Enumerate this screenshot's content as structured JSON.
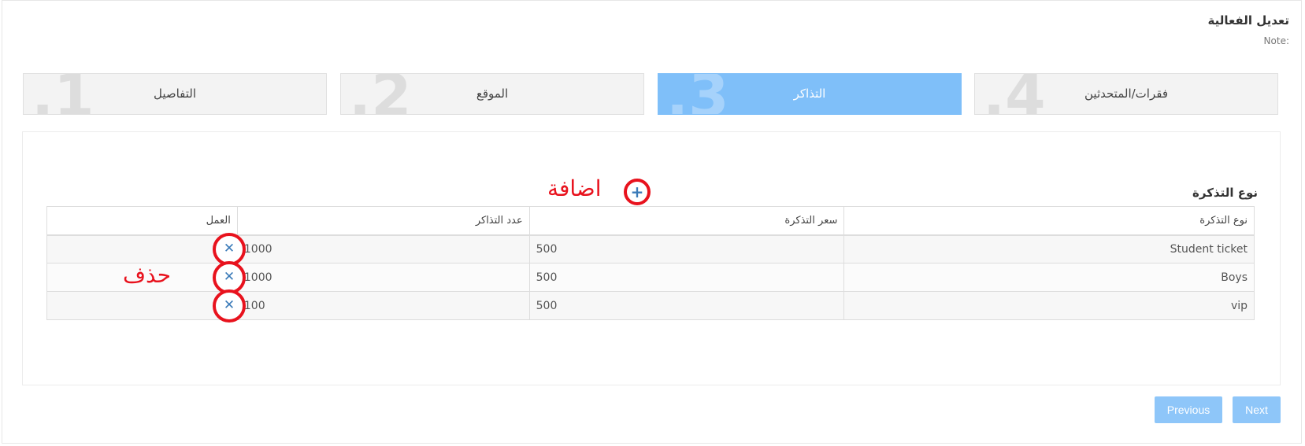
{
  "page": {
    "title": "تعديل الفعالية",
    "note": ":Note"
  },
  "steps": [
    {
      "number": ".1",
      "label": "التفاصيل",
      "active": false
    },
    {
      "number": ".2",
      "label": "الموقع",
      "active": false
    },
    {
      "number": ".3",
      "label": "التذاكر",
      "active": true
    },
    {
      "number": ".4",
      "label": "فقرات/المتحدثين",
      "active": false
    }
  ],
  "tickets": {
    "section_label": "نوع التذكرة",
    "add_annotation": "اضافة",
    "delete_annotation": "حذف",
    "columns": [
      "نوع التذكرة",
      "سعر التذكرة",
      "عدد التذاكر",
      "العمل"
    ],
    "rows": [
      {
        "type": "Student ticket",
        "price": "500",
        "count": "1000"
      },
      {
        "type": "Boys",
        "price": "500",
        "count": "1000"
      },
      {
        "type": "vip",
        "price": "500",
        "count": "100"
      }
    ]
  },
  "buttons": {
    "previous": "Previous",
    "next": "Next"
  },
  "icons": {
    "add": "plus-icon",
    "delete": "close-icon"
  },
  "colors": {
    "active_step": "#7fbff9",
    "annotation": "#e8121d",
    "button": "#8ec6f9"
  }
}
